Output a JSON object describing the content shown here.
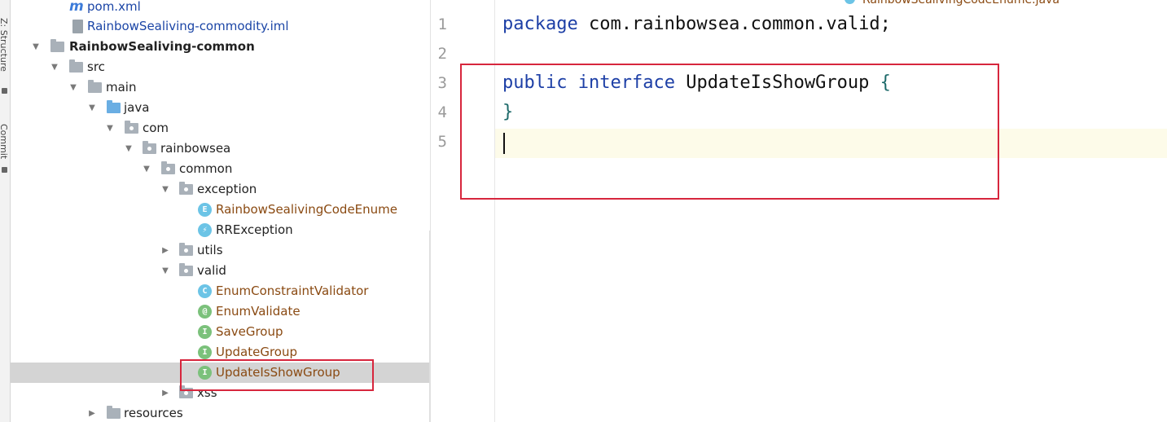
{
  "left_strip": {
    "tabs": [
      "Z: Structure",
      "Commit"
    ]
  },
  "project_tree": {
    "rows": [
      {
        "label": "pom.xml",
        "icon": "maven-icon",
        "style": "file",
        "arrow": ""
      },
      {
        "label": "RainbowSealiving-commodity.iml",
        "icon": "iml-file-icon",
        "style": "file",
        "arrow": ""
      },
      {
        "label": "RainbowSealiving-common",
        "icon": "module-folder-icon",
        "style": "bold",
        "arrow": "expanded"
      },
      {
        "label": "src",
        "icon": "folder-icon",
        "style": "",
        "arrow": "expanded"
      },
      {
        "label": "main",
        "icon": "folder-icon",
        "style": "",
        "arrow": "expanded"
      },
      {
        "label": "java",
        "icon": "source-folder-icon",
        "style": "",
        "arrow": "expanded"
      },
      {
        "label": "com",
        "icon": "package-icon",
        "style": "",
        "arrow": "expanded"
      },
      {
        "label": "rainbowsea",
        "icon": "package-icon",
        "style": "",
        "arrow": "expanded"
      },
      {
        "label": "common",
        "icon": "package-icon",
        "style": "",
        "arrow": "expanded"
      },
      {
        "label": "exception",
        "icon": "package-icon",
        "style": "",
        "arrow": "expanded"
      },
      {
        "label": "RainbowSealivingCodeEnume",
        "icon": "enum-icon",
        "badge": "E",
        "style": "cls",
        "arrow": ""
      },
      {
        "label": "RRException",
        "icon": "exception-class-icon",
        "badge": "⚡",
        "style": "",
        "arrow": ""
      },
      {
        "label": "utils",
        "icon": "package-icon",
        "style": "",
        "arrow": "collapsed"
      },
      {
        "label": "valid",
        "icon": "package-icon",
        "style": "",
        "arrow": "expanded"
      },
      {
        "label": "EnumConstraintValidator",
        "icon": "class-icon",
        "badge": "C",
        "style": "cls",
        "arrow": ""
      },
      {
        "label": "EnumValidate",
        "icon": "annotation-icon",
        "badge": "@",
        "style": "cls",
        "arrow": ""
      },
      {
        "label": "SaveGroup",
        "icon": "interface-icon",
        "badge": "I",
        "style": "cls",
        "arrow": ""
      },
      {
        "label": "UpdateGroup",
        "icon": "interface-icon",
        "badge": "I",
        "style": "cls",
        "arrow": ""
      },
      {
        "label": "UpdateIsShowGroup",
        "icon": "interface-icon",
        "badge": "I",
        "style": "cls",
        "arrow": "",
        "selected": true
      },
      {
        "label": "xss",
        "icon": "package-icon",
        "style": "",
        "arrow": "collapsed"
      },
      {
        "label": "resources",
        "icon": "folder-icon",
        "style": "",
        "arrow": "collapsed"
      }
    ]
  },
  "editor": {
    "top_tab_label": "RainbowSealivingCodeEnume.java",
    "line_numbers": [
      "1",
      "2",
      "3",
      "4",
      "5"
    ],
    "line1": {
      "kw": "package",
      "rest": " com.rainbowsea.common.valid;"
    },
    "line3": {
      "kw1": "public",
      "kw2": "interface",
      "name": " UpdateIsShowGroup ",
      "brace": "{"
    },
    "line4": {
      "brace": "}"
    }
  },
  "colors": {
    "highlight_box": "#d7263d",
    "keyword": "#1d3fa6",
    "class_name": "#8a4a12",
    "selection": "#d4d4d4",
    "current_line": "#fdfbe9"
  }
}
